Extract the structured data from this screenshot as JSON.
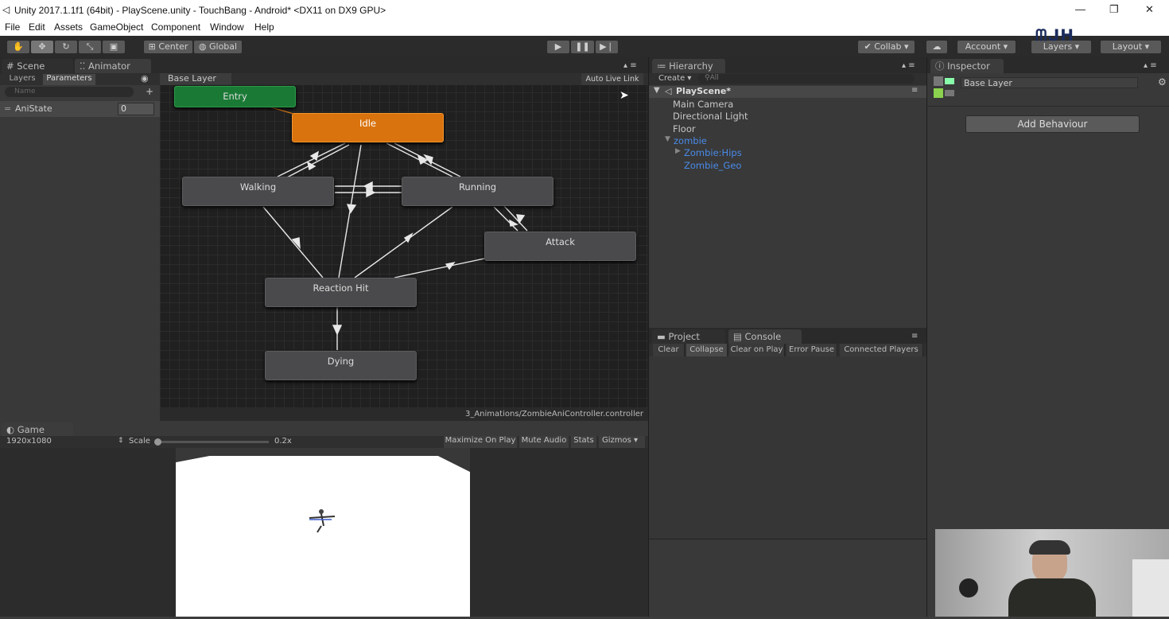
{
  "window": {
    "title": "Unity 2017.1.1f1 (64bit) - PlayScene.unity - TouchBang - Android* <DX11 on DX9 GPU>"
  },
  "menu": [
    "File",
    "Edit",
    "Assets",
    "GameObject",
    "Component",
    "Window",
    "Help"
  ],
  "toolbar": {
    "center": "Center",
    "global": "Global",
    "collab": "Collab",
    "account": "Account",
    "layers": "Layers",
    "layout": "Layout"
  },
  "tabs": {
    "scene": "Scene",
    "animator": "Animator",
    "hierarchy": "Hierarchy",
    "inspector": "Inspector",
    "project": "Project",
    "console": "Console",
    "game": "Game"
  },
  "animator": {
    "layers_tab": "Layers",
    "params_tab": "Parameters",
    "search_placeholder": "Name",
    "param_name": "AniState",
    "param_value": "0",
    "breadcrumb": "Base Layer",
    "live_link": "Auto Live Link",
    "path": "3_Animations/ZombieAniController.controller",
    "states": {
      "entry": "Entry",
      "idle": "Idle",
      "walking": "Walking",
      "running": "Running",
      "attack": "Attack",
      "reaction": "Reaction Hit",
      "dying": "Dying"
    }
  },
  "hierarchy": {
    "create": "Create",
    "search": "All",
    "scene": "PlayScene*",
    "items": [
      "Main Camera",
      "Directional Light",
      "Floor",
      "zombie",
      "Zombie:Hips",
      "Zombie_Geo"
    ]
  },
  "inspector": {
    "layer_name": "Base Layer",
    "add_behaviour": "Add Behaviour"
  },
  "console": {
    "buttons": [
      "Clear",
      "Collapse",
      "Clear on Play",
      "Error Pause",
      "Connected Players"
    ]
  },
  "game": {
    "resolution": "1920x1080",
    "scale_label": "Scale",
    "scale_value": "0.2x",
    "maximize": "Maximize On Play",
    "mute": "Mute Audio",
    "stats": "Stats",
    "gizmos": "Gizmos"
  },
  "colors": {
    "entry": "#1a7a35",
    "idle": "#d9730e",
    "node": "#4a4a4c"
  }
}
